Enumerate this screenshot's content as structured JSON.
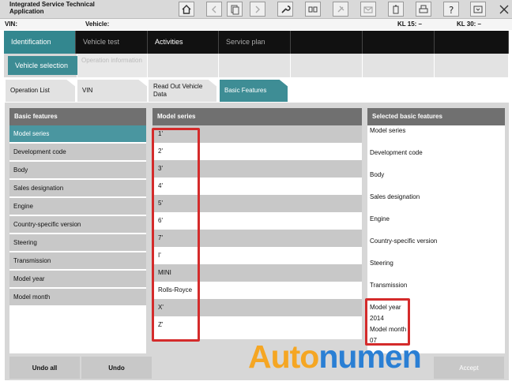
{
  "app": {
    "title": "Integrated Service Technical Application"
  },
  "info": {
    "vin_label": "VIN:",
    "vehicle_label": "Vehicle:",
    "kl15": "KL 15:  –",
    "kl30": "KL 30:  –"
  },
  "nav": {
    "items": [
      {
        "label": "Identification"
      },
      {
        "label": "Vehicle test"
      },
      {
        "label": "Activities"
      },
      {
        "label": "Service plan"
      }
    ]
  },
  "subnav": {
    "vehicle_selection": "Vehicle selection",
    "operation_information": "Operation information"
  },
  "tabs": [
    {
      "label": "Operation List"
    },
    {
      "label": "VIN"
    },
    {
      "label": "Read Out Vehicle Data"
    },
    {
      "label": "Basic Features"
    }
  ],
  "basic_features": {
    "header": "Basic features",
    "items": [
      "Model series",
      "Development code",
      "Body",
      "Sales designation",
      "Engine",
      "Country-specific version",
      "Steering",
      "Transmission",
      "Model year",
      "Model month"
    ]
  },
  "model_series": {
    "header": "Model series",
    "items": [
      "1'",
      "2'",
      "3'",
      "4'",
      "5'",
      "6'",
      "7'",
      "I'",
      "MINI",
      "Rolls-Royce",
      "X'",
      "Z'"
    ]
  },
  "selected": {
    "header": "Selected basic features",
    "items": [
      "Model series",
      "Development code",
      "Body",
      "Sales designation",
      "Engine",
      "Country-specific version",
      "Steering",
      "Transmission"
    ],
    "model_year_label": "Model year",
    "model_year_value": "2014",
    "model_month_label": "Model month",
    "model_month_value": "07"
  },
  "buttons": {
    "undo_all": "Undo all",
    "undo": "Undo",
    "accept": "Accept"
  },
  "watermark": {
    "part1": "Auto",
    "part2": "numen"
  },
  "colors": {
    "accent": "#3e8d95",
    "highlight": "#d42b2b",
    "watermark_blue": "#2a7fd4",
    "watermark_orange": "#f5a623"
  }
}
